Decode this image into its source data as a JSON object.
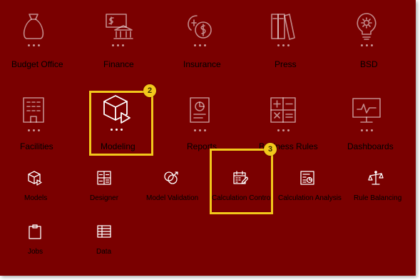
{
  "row1": [
    {
      "label": "Budget Office",
      "icon": "money-bag-icon"
    },
    {
      "label": "Finance",
      "icon": "bank-check-icon"
    },
    {
      "label": "Insurance",
      "icon": "coins-icon"
    },
    {
      "label": "Press",
      "icon": "books-icon"
    },
    {
      "label": "BSD",
      "icon": "lightbulb-icon"
    }
  ],
  "row2": [
    {
      "label": "Facilities",
      "icon": "building-icon"
    },
    {
      "label": "Modeling",
      "icon": "cube-play-icon"
    },
    {
      "label": "Reports",
      "icon": "report-icon"
    },
    {
      "label": "Business Rules",
      "icon": "calculator-icon"
    },
    {
      "label": "Dashboards",
      "icon": "monitor-chart-icon"
    }
  ],
  "cards": [
    {
      "label": "Models",
      "icon": "cube-icon"
    },
    {
      "label": "Designer",
      "icon": "designer-icon"
    },
    {
      "label": "Model Validation",
      "icon": "validation-icon"
    },
    {
      "label": "Calculation Control",
      "icon": "calendar-edit-icon"
    },
    {
      "label": "Calculation Analysis",
      "icon": "analysis-icon"
    },
    {
      "label": "Rule Balancing",
      "icon": "balance-icon"
    },
    {
      "label": "Jobs",
      "icon": "clipboard-icon"
    },
    {
      "label": "Data",
      "icon": "grid-icon"
    }
  ],
  "callouts": [
    {
      "number": "2"
    },
    {
      "number": "3"
    }
  ],
  "colors": {
    "background": "#7a0000",
    "highlight": "#f2c81b"
  }
}
